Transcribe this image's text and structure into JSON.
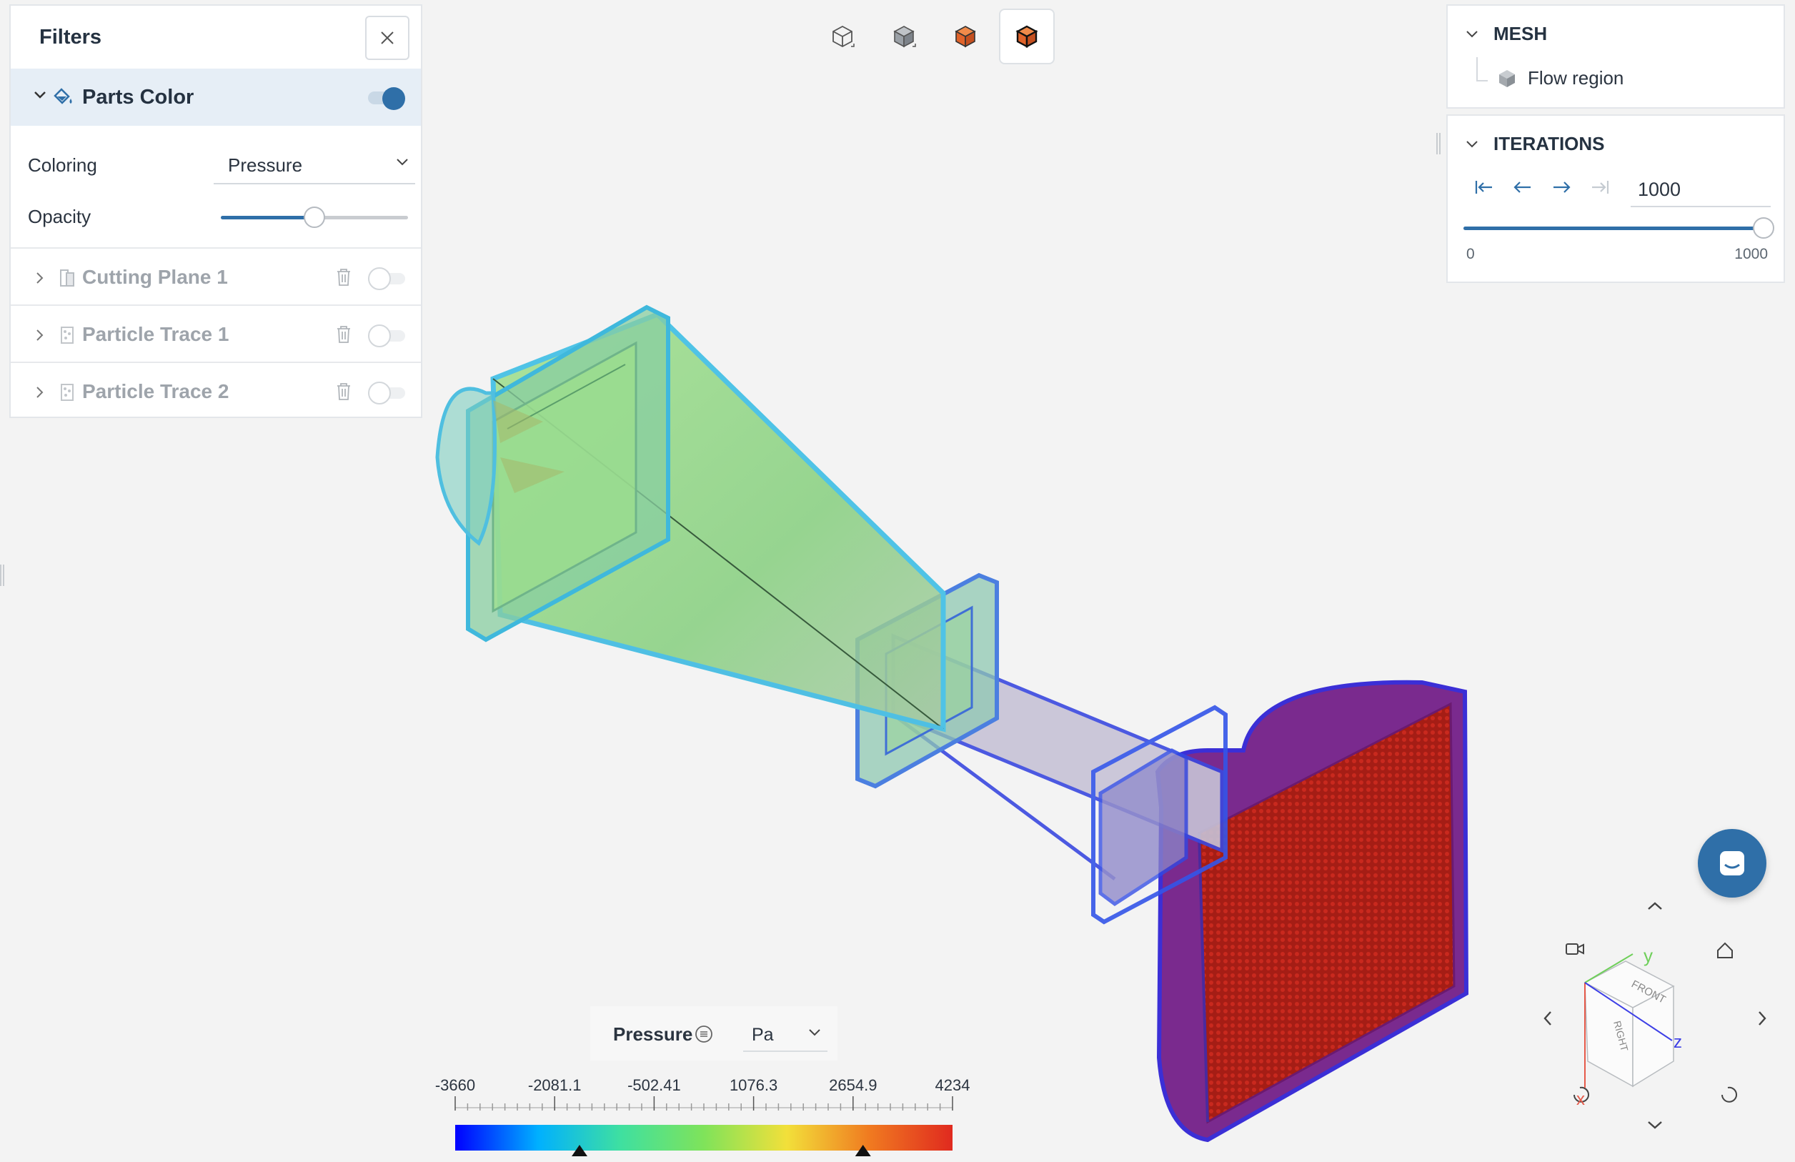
{
  "filters": {
    "title": "Filters",
    "parts_color": {
      "label": "Parts Color",
      "enabled": true
    },
    "coloring": {
      "label": "Coloring",
      "value": "Pressure"
    },
    "opacity": {
      "label": "Opacity",
      "value_fraction": 0.5
    },
    "items": [
      {
        "label": "Cutting Plane 1",
        "enabled": false,
        "icon": "cutting-plane-icon"
      },
      {
        "label": "Particle Trace 1",
        "enabled": false,
        "icon": "particle-trace-icon"
      },
      {
        "label": "Particle Trace 2",
        "enabled": false,
        "icon": "particle-trace-icon"
      }
    ]
  },
  "view_toolbar": {
    "buttons": [
      {
        "name": "wireframe-view",
        "icon": "wireframe-cube-icon"
      },
      {
        "name": "surface-view",
        "icon": "solid-cube-icon"
      },
      {
        "name": "colored-surface-view",
        "icon": "colored-cube-icon"
      },
      {
        "name": "colored-edges-view",
        "icon": "colored-edges-cube-icon",
        "active": true
      }
    ]
  },
  "mesh": {
    "title": "MESH",
    "region": "Flow region"
  },
  "iterations": {
    "title": "ITERATIONS",
    "current": "1000",
    "min": "0",
    "max": "1000",
    "progress_fraction": 1.0
  },
  "legend": {
    "title": "Pressure",
    "unit": "Pa",
    "ticks": [
      "-3660",
      "-2081.1",
      "-502.41",
      "1076.3",
      "2654.9",
      "4234"
    ],
    "colors": [
      "#0000ff",
      "#00b0ff",
      "#3fe0a0",
      "#7fe35a",
      "#f2e03a",
      "#f07a20",
      "#e02a1f"
    ],
    "marker_fractions": [
      0.25,
      0.82
    ]
  },
  "view_cube": {
    "faces": [
      "FRONT",
      "RIGHT"
    ],
    "axes": [
      "y",
      "z",
      "x"
    ]
  },
  "colors": {
    "accent": "#2f6fa8",
    "panel_border": "#e3e6ea"
  }
}
